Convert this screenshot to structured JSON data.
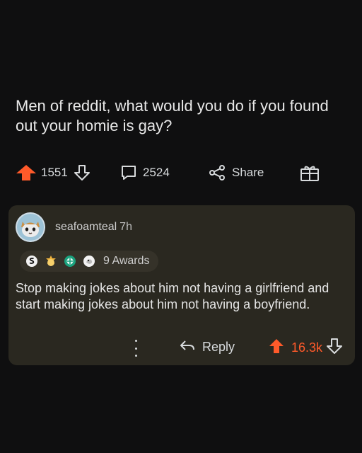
{
  "post": {
    "title": "Men of reddit, what would you do if you found out your homie is gay?",
    "vote_count": "1551",
    "comment_count": "2524",
    "share_label": "Share"
  },
  "comment": {
    "username": "seafoamteal",
    "timestamp": "7h",
    "awards_label": "9 Awards",
    "body": "Stop making jokes about him not having a girlfriend and start making jokes about him not having a boyfriend.",
    "reply_label": "Reply",
    "score": "16.3k"
  },
  "icons": [
    "upvote-icon",
    "downvote-icon",
    "comment-icon",
    "share-icon",
    "gift-icon",
    "avatar-icon",
    "award-icon",
    "more-icon",
    "reply-icon"
  ],
  "colors": {
    "accent": "#ff5a2a",
    "background": "#0f0f10",
    "comment_card": "#2a2820",
    "awards_pill": "#353229",
    "text": "#d7dadc"
  }
}
